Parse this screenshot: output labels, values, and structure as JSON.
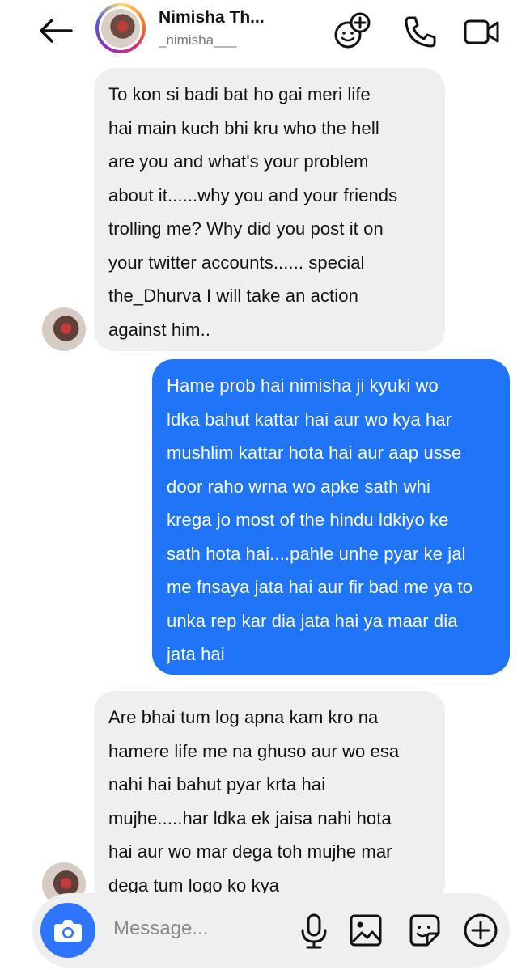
{
  "header": {
    "name": "Nimisha Th...",
    "username": "_nimisha___",
    "icons": [
      "back-arrow-icon",
      "add-effect-icon",
      "phone-icon",
      "video-camera-icon"
    ]
  },
  "messages": [
    {
      "side": "incoming",
      "lines": [
        "To kon si badi bat ho gai meri life",
        "hai main kuch bhi kru who the hell",
        "are you and what's your problem",
        "about it......why you and your friends",
        "trolling me? Why did you post it on",
        "your twitter accounts...... special",
        "the_Dhurva I will take an action",
        "against him.."
      ]
    },
    {
      "side": "outgoing",
      "lines": [
        "Hame prob hai nimisha ji kyuki wo",
        "ldka bahut kattar hai aur wo kya har",
        "mushlim kattar hota hai aur aap usse",
        "door raho wrna wo apke sath whi",
        "krega jo most of the hindu ldkiyo ke",
        "sath hota hai....pahle unhe pyar ke jal",
        "me fnsaya jata hai aur fir bad me ya to",
        "unka rep kar dia jata hai ya maar dia",
        "jata hai"
      ]
    },
    {
      "side": "incoming",
      "lines": [
        "Are bhai tum log apna kam kro na",
        "hamere life me na ghuso aur wo esa",
        "nahi hai bahut pyar krta hai",
        "mujhe.....har ldka ek jaisa nahi hota",
        "hai aur wo mar dega toh mujhe mar",
        "dega tum logo ko kya"
      ]
    }
  ],
  "composer": {
    "placeholder": "Message...",
    "icons": [
      "camera-icon",
      "microphone-icon",
      "gallery-icon",
      "sticker-icon",
      "add-icon"
    ]
  },
  "colors": {
    "outgoing_bubble": "#1f74f7",
    "incoming_bubble": "#efefef",
    "camera_button": "#2f74ff"
  }
}
